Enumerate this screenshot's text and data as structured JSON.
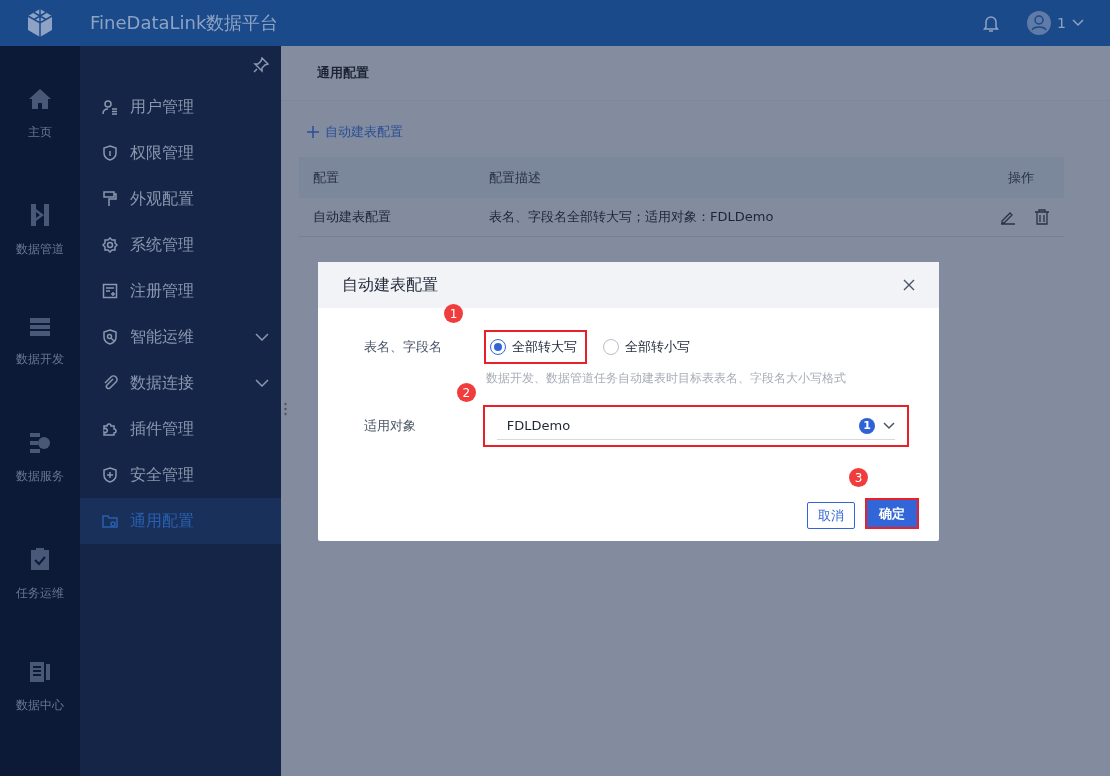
{
  "header": {
    "title": "FineDataLink数据平台",
    "user": "1"
  },
  "rail": [
    {
      "label": "主页"
    },
    {
      "label": "数据管道"
    },
    {
      "label": "数据开发"
    },
    {
      "label": "数据服务"
    },
    {
      "label": "任务运维"
    },
    {
      "label": "数据中心"
    }
  ],
  "sidebar": {
    "items": [
      {
        "label": "用户管理",
        "selected": false,
        "expandable": false
      },
      {
        "label": "权限管理",
        "selected": false,
        "expandable": false
      },
      {
        "label": "外观配置",
        "selected": false,
        "expandable": false
      },
      {
        "label": "系统管理",
        "selected": false,
        "expandable": false
      },
      {
        "label": "注册管理",
        "selected": false,
        "expandable": false
      },
      {
        "label": "智能运维",
        "selected": false,
        "expandable": true
      },
      {
        "label": "数据连接",
        "selected": false,
        "expandable": true
      },
      {
        "label": "插件管理",
        "selected": false,
        "expandable": false
      },
      {
        "label": "安全管理",
        "selected": false,
        "expandable": false
      },
      {
        "label": "通用配置",
        "selected": true,
        "expandable": false
      }
    ]
  },
  "page": {
    "title": "通用配置",
    "add_button": "自动建表配置",
    "table": {
      "columns": [
        "配置",
        "配置描述",
        "操作"
      ],
      "rows": [
        {
          "cells": [
            "自动建表配置",
            "表名、字段名全部转大写；适用对象：FDLDemo"
          ]
        }
      ]
    }
  },
  "dialog": {
    "title": "自动建表配置",
    "case_label": "表名、字段名",
    "options": [
      {
        "label": "全部转大写",
        "selected": true,
        "highlighted": true
      },
      {
        "label": "全部转小写",
        "selected": false,
        "highlighted": false
      }
    ],
    "hint": "数据开发、数据管道任务自动建表时目标表表名、字段名大小写格式",
    "target_label": "适用对象",
    "target_value": "FDLDemo",
    "target_count": "1",
    "target_highlighted": true,
    "cancel": "取消",
    "confirm": "确定",
    "confirm_highlighted": true,
    "steps": [
      "1",
      "2",
      "3"
    ]
  }
}
